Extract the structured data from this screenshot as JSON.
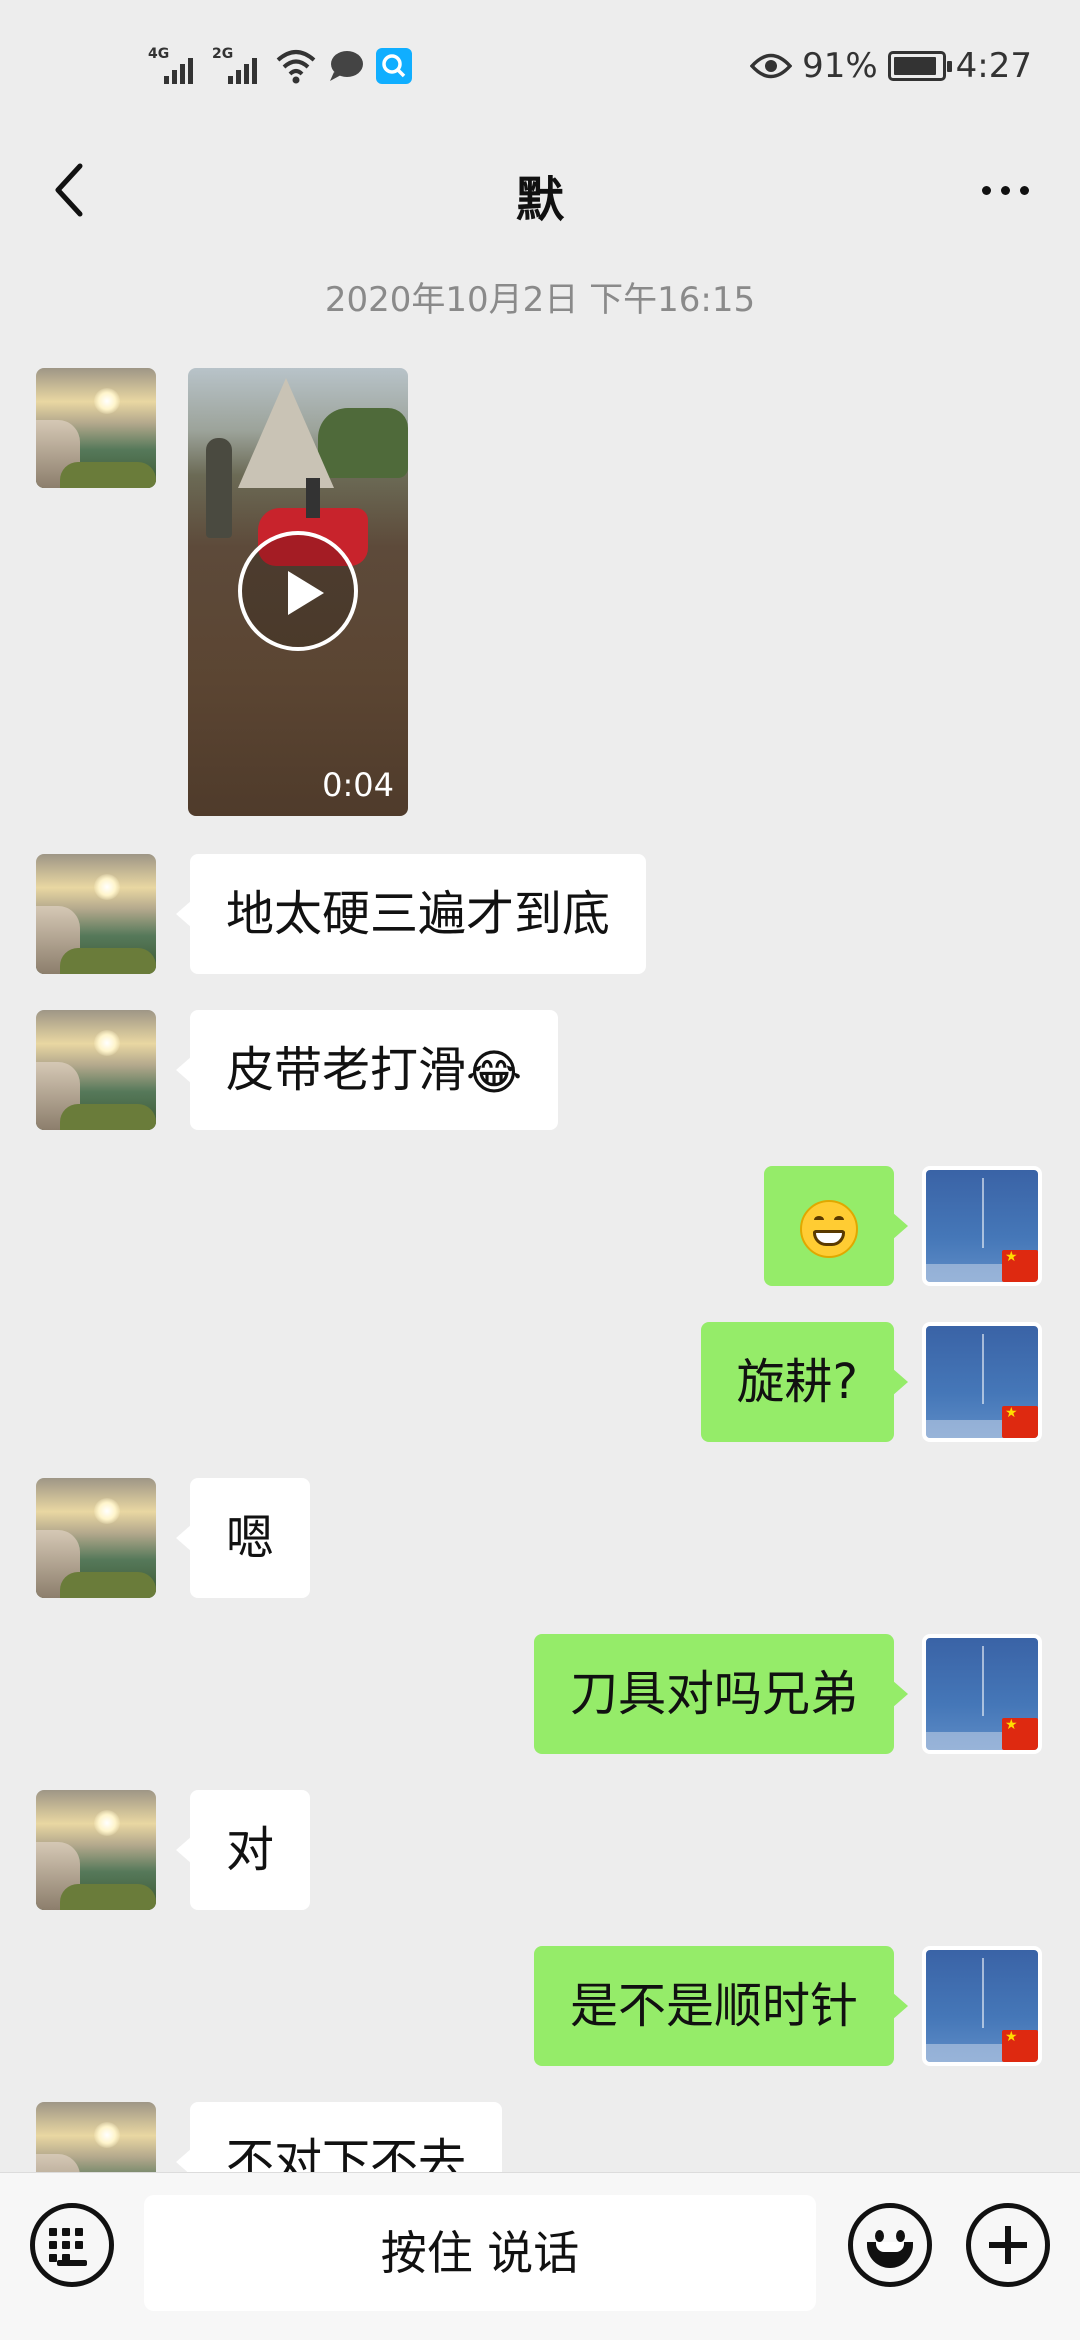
{
  "status_bar": {
    "network_1": "4G",
    "network_2": "2G",
    "battery_percent": "91%",
    "battery_level": 0.91,
    "time": "4:27"
  },
  "header": {
    "title": "默"
  },
  "chat": {
    "timestamp": "2020年10月2日 下午16:15",
    "video_duration": "0:04",
    "messages": [
      {
        "side": "in",
        "text": "地太硬三遍才到底"
      },
      {
        "side": "in",
        "text": "皮带老打滑"
      },
      {
        "side": "out",
        "text": ""
      },
      {
        "side": "out",
        "text": "旋耕?"
      },
      {
        "side": "in",
        "text": "嗯"
      },
      {
        "side": "out",
        "text": "刀具对吗兄弟"
      },
      {
        "side": "in",
        "text": "对"
      },
      {
        "side": "out",
        "text": "是不是顺时针"
      },
      {
        "side": "in",
        "text": "不对下不去"
      }
    ]
  },
  "input_bar": {
    "hold_to_talk": "按住 说话"
  },
  "colors": {
    "background": "#ededed",
    "outgoing_bubble": "#95ec69",
    "incoming_bubble": "#ffffff"
  }
}
